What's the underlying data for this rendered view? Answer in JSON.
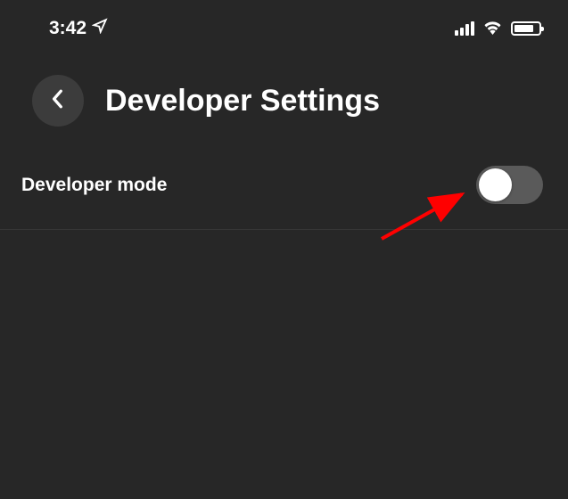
{
  "status_bar": {
    "time": "3:42"
  },
  "header": {
    "title": "Developer Settings"
  },
  "settings": {
    "developer_mode": {
      "label": "Developer mode",
      "enabled": false
    }
  }
}
